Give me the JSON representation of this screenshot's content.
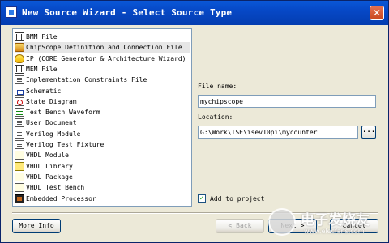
{
  "window": {
    "title": "New Source Wizard - Select Source Type",
    "close_glyph": "✕"
  },
  "source_types": [
    {
      "label": "BMM File",
      "icon": "bmm-file-icon",
      "selected": false
    },
    {
      "label": "ChipScope Definition and Connection File",
      "icon": "chipscope-icon",
      "selected": true
    },
    {
      "label": "IP (CORE Generator & Architecture Wizard)",
      "icon": "ip-core-icon",
      "selected": false
    },
    {
      "label": "MEM File",
      "icon": "mem-file-icon",
      "selected": false
    },
    {
      "label": "Implementation Constraints File",
      "icon": "constraints-file-icon",
      "selected": false
    },
    {
      "label": "Schematic",
      "icon": "schematic-icon",
      "selected": false
    },
    {
      "label": "State Diagram",
      "icon": "state-diagram-icon",
      "selected": false
    },
    {
      "label": "Test Bench Waveform",
      "icon": "waveform-icon",
      "selected": false
    },
    {
      "label": "User Document",
      "icon": "document-icon",
      "selected": false
    },
    {
      "label": "Verilog Module",
      "icon": "verilog-module-icon",
      "selected": false
    },
    {
      "label": "Verilog Test Fixture",
      "icon": "verilog-fixture-icon",
      "selected": false
    },
    {
      "label": "VHDL Module",
      "icon": "vhdl-module-icon",
      "selected": false
    },
    {
      "label": "VHDL Library",
      "icon": "vhdl-library-icon",
      "selected": false
    },
    {
      "label": "VHDL Package",
      "icon": "vhdl-package-icon",
      "selected": false
    },
    {
      "label": "VHDL Test Bench",
      "icon": "vhdl-testbench-icon",
      "selected": false
    },
    {
      "label": "Embedded Processor",
      "icon": "processor-icon",
      "selected": false
    }
  ],
  "form": {
    "file_name_label": "File name:",
    "file_name_value": "mychipscope",
    "location_label": "Location:",
    "location_value": "G:\\Work\\ISE\\isev10pi\\mycounter",
    "browse_label": "...",
    "add_to_project_label": "Add to project",
    "add_to_project_checked": true
  },
  "buttons": {
    "more_info": "More Info",
    "back": "< Back",
    "next": "Next >",
    "cancel": "Cancel"
  },
  "watermark": {
    "text": "电子发烧友",
    "url": "www.elecfans.com"
  }
}
